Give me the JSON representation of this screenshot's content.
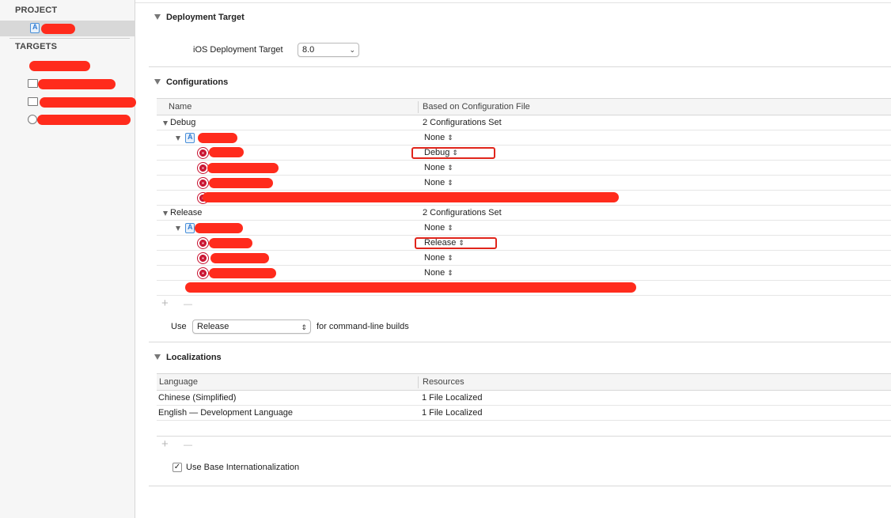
{
  "sidebar": {
    "project_header": "PROJECT",
    "targets_header": "TARGETS"
  },
  "deployment": {
    "title": "Deployment Target",
    "field_label": "iOS Deployment Target",
    "value": "8.0"
  },
  "configurations": {
    "title": "Configurations",
    "col_name": "Name",
    "col_based_on": "Based on Configuration File",
    "debug": {
      "label": "Debug",
      "summary": "2 Configurations Set",
      "project_value": "None",
      "rows": [
        "Debug",
        "None",
        "None"
      ]
    },
    "release": {
      "label": "Release",
      "summary": "2 Configurations Set",
      "project_value": "None",
      "rows": [
        "Release",
        "None",
        "None"
      ]
    },
    "plus": "+",
    "minus": "—",
    "use_label": "Use",
    "use_value": "Release",
    "use_suffix": "for command-line builds"
  },
  "localizations": {
    "title": "Localizations",
    "col_language": "Language",
    "col_resources": "Resources",
    "rows": [
      {
        "language": "Chinese (Simplified)",
        "resources": "1 File Localized"
      },
      {
        "language": "English — Development Language",
        "resources": "1 File Localized"
      }
    ],
    "plus": "+",
    "minus": "—",
    "base_intl_label": "Use Base Internationalization",
    "base_intl_checked": true
  },
  "icons": {
    "popup_chevron": "⌃⌄",
    "checkmark": "✓"
  },
  "colors": {
    "redaction": "#ff2b1c",
    "highlight_box": "#e0251b",
    "target_icon": "#c8102e"
  }
}
